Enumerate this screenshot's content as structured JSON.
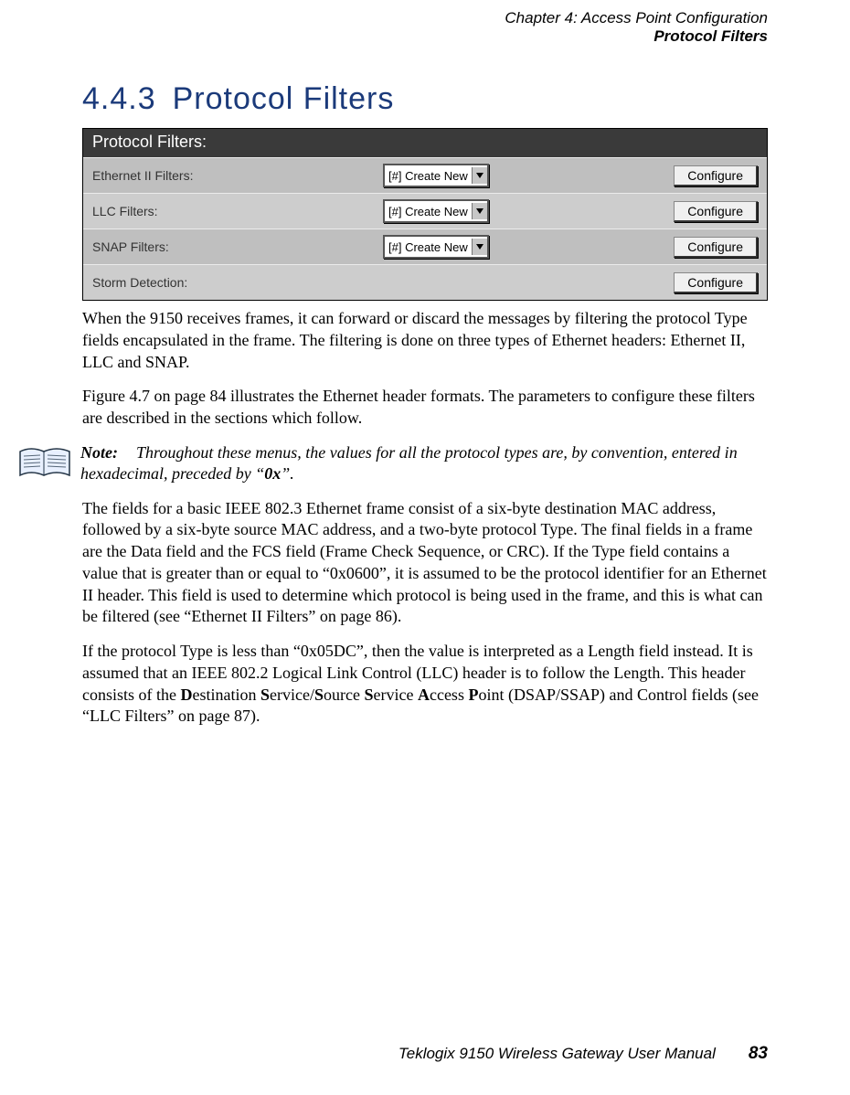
{
  "header": {
    "chapter_line": "Chapter 4:  Access Point Configuration",
    "section_line": "Protocol Filters"
  },
  "heading": {
    "number": "4.4.3",
    "title": "Protocol Filters"
  },
  "panel": {
    "title": "Protocol Filters:",
    "rows": [
      {
        "label": "Ethernet II Filters:",
        "select": "[#] Create New",
        "button": "Configure"
      },
      {
        "label": "LLC Filters:",
        "select": "[#] Create New",
        "button": "Configure"
      },
      {
        "label": "SNAP Filters:",
        "select": "[#] Create New",
        "button": "Configure"
      },
      {
        "label": "Storm Detection:",
        "select": null,
        "button": "Configure"
      }
    ]
  },
  "paragraphs": {
    "p1": "When the 9150 receives frames, it can forward or discard the messages by filtering the protocol Type fields encapsulated in the frame. The filtering is done on three types of Ethernet headers: Ethernet II, LLC and SNAP.",
    "p2": "Figure 4.7 on page 84 illustrates the Ethernet header formats. The parameters to configure these filters are described in the sections which follow.",
    "note_label": "Note:",
    "note_body_pre": "Throughout these menus, the values for all the protocol types are, by convention, entered in hexadecimal, preceded by “",
    "note_hex": "0x",
    "note_body_post": "”.",
    "p3": "The fields for a basic IEEE 802.3 Ethernet frame consist of a six-byte destination MAC address, followed by a six-byte source MAC address, and a two-byte protocol Type. The final fields in a frame are the Data field and the FCS field (Frame Check Sequence, or CRC). If the Type field contains a value that is greater than or equal to “0x0600”, it is assumed to be the protocol identifier for an Ethernet II header. This field is used to determine which protocol is being used in the frame, and this is what can be filtered (see “Ethernet II Filters” on page 86).",
    "p4_pre": "If the protocol Type is less than “0x05DC”, then the value is interpreted as a Length field instead. It is assumed that an IEEE 802.2 Logical Link Control (LLC) header is to follow the Length. This header consists of the ",
    "p4_d": "D",
    "p4_mid1": "estination ",
    "p4_s1": "S",
    "p4_mid2": "ervice/",
    "p4_s2": "S",
    "p4_mid3": "ource ",
    "p4_s3": "S",
    "p4_mid4": "ervice ",
    "p4_a": "A",
    "p4_mid5": "ccess ",
    "p4_p": "P",
    "p4_post": "oint (DSAP/SSAP) and Control fields (see “LLC Filters” on page 87)."
  },
  "footer": {
    "manual": "Teklogix 9150 Wireless Gateway User Manual",
    "page": "83"
  }
}
